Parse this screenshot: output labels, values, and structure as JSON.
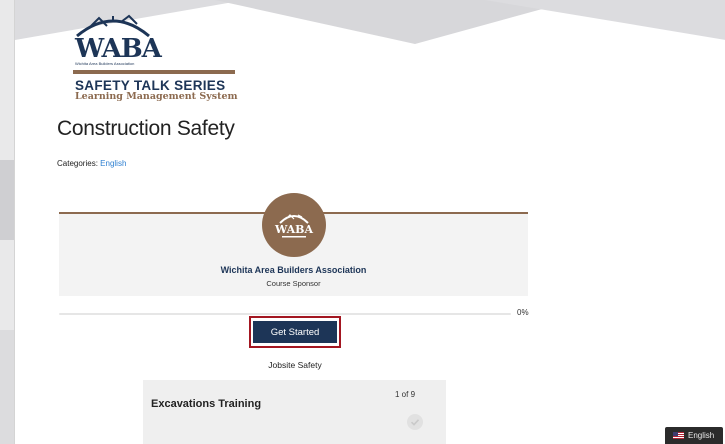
{
  "brand": {
    "logo_word": "WABA",
    "logo_tagline": "Wichita Area Builders Association",
    "series_title": "SAFETY TALK SERIES",
    "series_subtitle": "Learning Management System",
    "primary_color": "#1d3557",
    "accent_color": "#8c6a4f"
  },
  "course": {
    "title": "Construction Safety",
    "categories_label": "Categories:",
    "category": "English"
  },
  "sponsor": {
    "avatar_icon": "waba-logo-icon",
    "avatar_word": "WABA",
    "name": "Wichita Area Builders Association",
    "role": "Course Sponsor"
  },
  "progress": {
    "percent": 0,
    "label": "0%"
  },
  "actions": {
    "get_started_label": "Get Started",
    "highlight_color": "#a31621"
  },
  "module": {
    "heading": "Jobsite Safety",
    "lessons": [
      {
        "title": "Excavations Training",
        "count": "1 of 9",
        "status_icon": "check-circle-icon"
      }
    ]
  },
  "language_switcher": {
    "icon": "us-flag-icon",
    "label": "English"
  }
}
